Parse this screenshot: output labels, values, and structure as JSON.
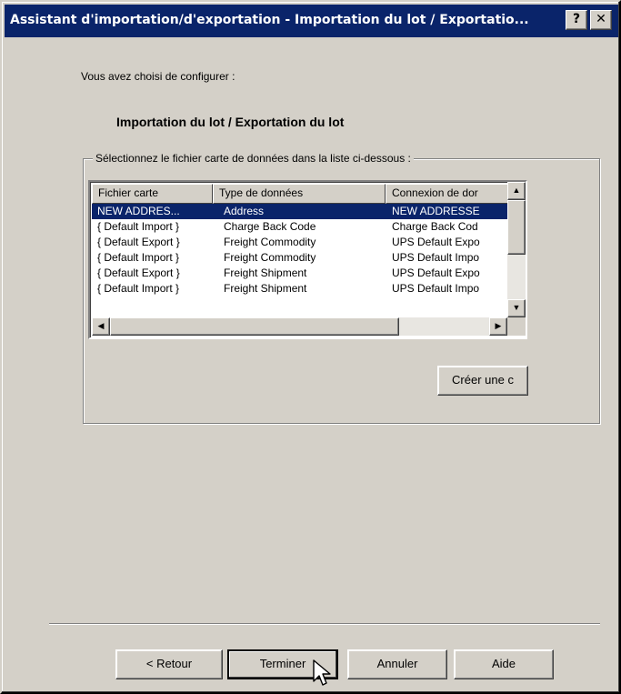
{
  "window": {
    "title": "Assistant d'importation/d'exportation - Importation du lot / Exportatio...",
    "help_label": "?",
    "close_label": "✕"
  },
  "content": {
    "intro": "Vous avez choisi de configurer :",
    "headline": "Importation du lot / Exportation du lot",
    "group_label": "Sélectionnez le fichier carte de données dans la liste ci-dessous :"
  },
  "list": {
    "columns": [
      "Fichier carte",
      "Type de données",
      "Connexion de dor"
    ],
    "rows": [
      {
        "file": "NEW ADDRES...",
        "type": "Address",
        "connection": "NEW ADDRESSE",
        "selected": true
      },
      {
        "file": "{ Default Import }",
        "type": "Charge Back Code",
        "connection": "Charge Back Cod",
        "selected": false
      },
      {
        "file": "{ Default Export }",
        "type": "Freight Commodity",
        "connection": "UPS Default Expo",
        "selected": false
      },
      {
        "file": "{ Default Import }",
        "type": "Freight Commodity",
        "connection": "UPS Default Impo",
        "selected": false
      },
      {
        "file": "{ Default Export }",
        "type": "Freight Shipment",
        "connection": "UPS Default Expo",
        "selected": false
      },
      {
        "file": "{ Default Import }",
        "type": "Freight Shipment",
        "connection": "UPS Default Impo",
        "selected": false
      }
    ]
  },
  "create_button": "Créer une c",
  "footer": {
    "back": "< Retour",
    "finish": "Terminer",
    "cancel": "Annuler",
    "help": "Aide"
  },
  "colors": {
    "face": "#d4d0c8",
    "selection": "#0a246a",
    "titlebar": "#0a246a"
  }
}
